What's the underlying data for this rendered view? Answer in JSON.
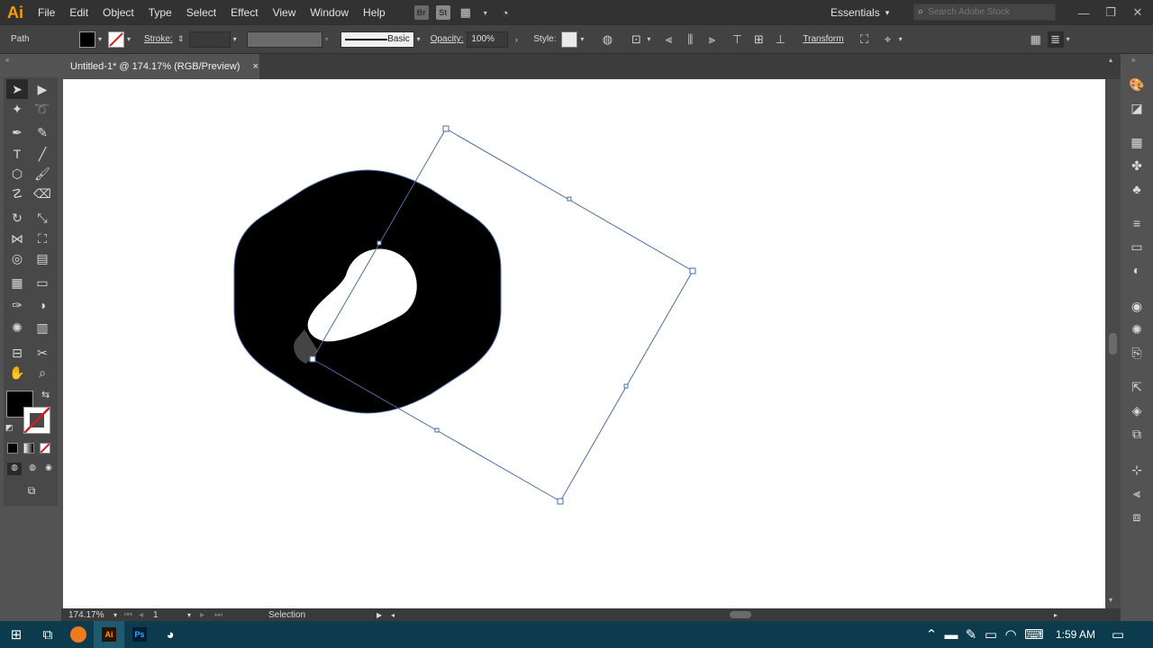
{
  "app": {
    "logo": "Ai"
  },
  "menu": [
    "File",
    "Edit",
    "Object",
    "Type",
    "Select",
    "Effect",
    "View",
    "Window",
    "Help"
  ],
  "menu_icons": [
    "Br",
    "St"
  ],
  "workspace": {
    "label": "Essentials"
  },
  "stock_search": {
    "placeholder": "Search Adobe Stock"
  },
  "control": {
    "object_type": "Path",
    "stroke_label": "Stroke:",
    "brush_label": "Basic",
    "opacity_label": "Opacity:",
    "opacity_value": "100%",
    "style_label": "Style:",
    "transform_label": "Transform",
    "fill_color": "#000000"
  },
  "document": {
    "tab_title": "Untitled-1* @ 174.17% (RGB/Preview)",
    "close": "×"
  },
  "status": {
    "zoom": "174.17%",
    "artboard": "1",
    "tool": "Selection"
  },
  "taskbar": {
    "time": "1:59 AM"
  },
  "colors": {
    "accent": "#ff9a00",
    "selection": "#4a6fa5",
    "ps": "#31a8ff"
  },
  "icons": {
    "tools": [
      "selection-icon",
      "direct-selection-icon",
      "magic-wand-icon",
      "lasso-icon",
      "pen-icon",
      "curvature-icon",
      "type-icon",
      "line-segment-icon",
      "shape-icon",
      "paintbrush-icon",
      "shaper-icon",
      "eraser-icon",
      "rotate-icon",
      "scale-icon",
      "width-icon",
      "free-transform-icon",
      "shape-builder-icon",
      "perspective-grid-icon",
      "mesh-icon",
      "gradient-icon",
      "eyedropper-icon",
      "blend-icon",
      "symbol-sprayer-icon",
      "column-graph-icon",
      "artboard-icon",
      "slice-icon",
      "hand-icon",
      "zoom-icon"
    ],
    "panels": [
      "color-icon",
      "color-guide-icon",
      "libraries-icon",
      "brushes-icon",
      "symbols-icon",
      "stroke-icon",
      "gradient-icon",
      "transparency-icon",
      "appearance-icon",
      "graphic-styles-icon",
      "asset-export-icon",
      "layers-icon",
      "artboards-icon",
      "transform-icon",
      "align-icon",
      "pathfinder-icon"
    ]
  }
}
